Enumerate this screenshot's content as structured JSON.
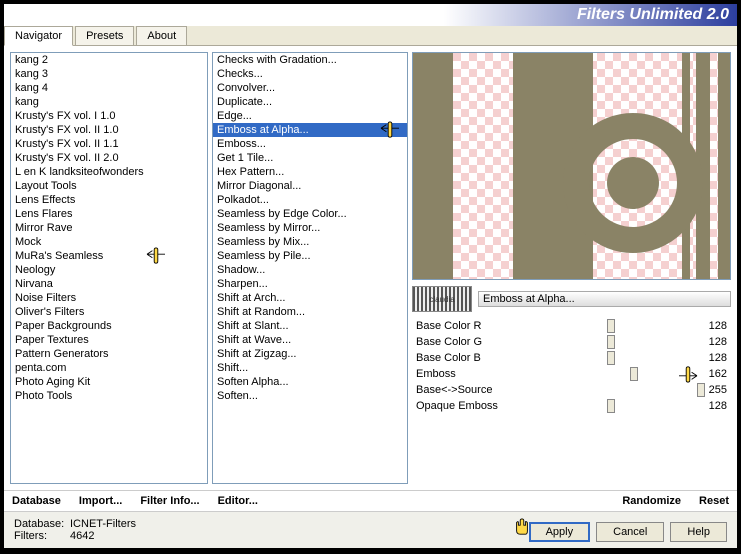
{
  "title": "Filters Unlimited 2.0",
  "tabs": {
    "navigator": "Navigator",
    "presets": "Presets",
    "about": "About"
  },
  "categories": [
    "kang 2",
    "kang 3",
    "kang 4",
    "kang",
    "Krusty's FX vol. I 1.0",
    "Krusty's FX vol. II 1.0",
    "Krusty's FX vol. II 1.1",
    "Krusty's FX vol. II 2.0",
    "L en K landksiteofwonders",
    "Layout Tools",
    "Lens Effects",
    "Lens Flares",
    "Mirror Rave",
    "Mock",
    "MuRa's Seamless",
    "Neology",
    "Nirvana",
    "Noise Filters",
    "Oliver's Filters",
    "Paper Backgrounds",
    "Paper Textures",
    "Pattern Generators",
    "penta.com",
    "Photo Aging Kit",
    "Photo Tools"
  ],
  "filters": [
    "Checks with Gradation...",
    "Checks...",
    "Convolver...",
    "Duplicate...",
    "Edge...",
    "Emboss at Alpha...",
    "Emboss...",
    "Get 1 Tile...",
    "Hex Pattern...",
    "Mirror Diagonal...",
    "Polkadot...",
    "Seamless by Edge Color...",
    "Seamless by Mirror...",
    "Seamless by Mix...",
    "Seamless by Pile...",
    "Shadow...",
    "Sharpen...",
    "Shift at Arch...",
    "Shift at Random...",
    "Shift at Slant...",
    "Shift at Wave...",
    "Shift at Zigzag...",
    "Shift...",
    "Soften Alpha...",
    "Soften..."
  ],
  "selected_category": "MuRa's Seamless",
  "selected_filter": "Emboss at Alpha...",
  "logo_text": "claudia",
  "params": [
    {
      "name": "Base Color R",
      "value": "128",
      "pct": 50
    },
    {
      "name": "Base Color G",
      "value": "128",
      "pct": 50
    },
    {
      "name": "Base Color B",
      "value": "128",
      "pct": 50
    },
    {
      "name": "Emboss",
      "value": "162",
      "pct": 63
    },
    {
      "name": "Base<->Source",
      "value": "255",
      "pct": 100
    },
    {
      "name": "Opaque Emboss",
      "value": "128",
      "pct": 50
    }
  ],
  "buttons": {
    "database": "Database",
    "import": "Import...",
    "filter_info": "Filter Info...",
    "editor": "Editor...",
    "randomize": "Randomize",
    "reset": "Reset",
    "apply": "Apply",
    "cancel": "Cancel",
    "help": "Help"
  },
  "status": {
    "db_label": "Database:",
    "db_value": "ICNET-Filters",
    "filters_label": "Filters:",
    "filters_value": "4642"
  }
}
